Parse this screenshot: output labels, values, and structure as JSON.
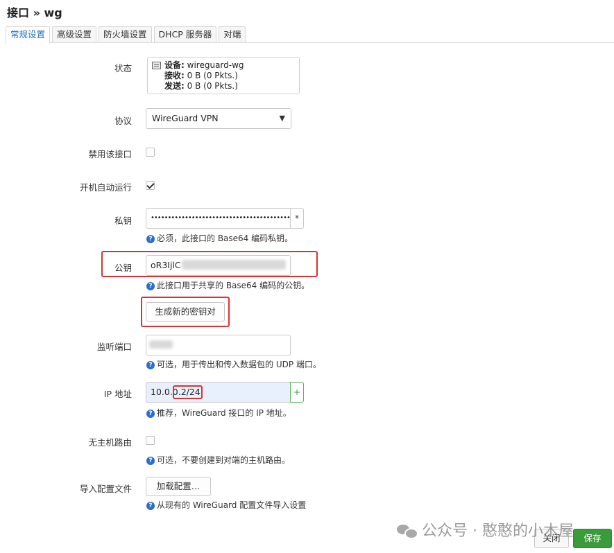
{
  "page": {
    "title": "接口 » wg"
  },
  "tabs": [
    "常规设置",
    "高级设置",
    "防火墙设置",
    "DHCP 服务器",
    "对端"
  ],
  "status": {
    "label": "状态",
    "device_key": "设备:",
    "device_value": "wireguard-wg",
    "rx_key": "接收:",
    "rx_value": "0 B (0 Pkts.)",
    "tx_key": "发送:",
    "tx_value": "0 B (0 Pkts.)"
  },
  "protocol": {
    "label": "协议",
    "value": "WireGuard VPN"
  },
  "disable": {
    "label": "禁用该接口",
    "checked": false
  },
  "autostart": {
    "label": "开机自动运行",
    "checked": true
  },
  "private_key": {
    "label": "私钥",
    "value": "•••••••••••••••••••••••••••••••••••••••••••",
    "toggle": "*",
    "help": "必须，此接口的 Base64 编码私钥。"
  },
  "public_key": {
    "label": "公钥",
    "value": "oR3IjlC",
    "help": "此接口用于共享的 Base64 编码的公钥。"
  },
  "generate": {
    "label": "生成新的密钥对"
  },
  "listen_port": {
    "label": "监听端口",
    "help": "可选，用于传出和传入数据包的 UDP 端口。"
  },
  "ip": {
    "label": "IP 地址",
    "value": "10.0.0.2/24",
    "add": "+",
    "help": "推荐，WireGuard 接口的 IP 地址。"
  },
  "nohostroute": {
    "label": "无主机路由",
    "checked": false,
    "help": "可选，不要创建到对端的主机路由。"
  },
  "import_config": {
    "label": "导入配置文件",
    "button": "加载配置…",
    "help": "从现有的 WireGuard 配置文件导入设置"
  },
  "watermark": "公众号 · 憨憨的小木屋",
  "footer": {
    "close": "关闭",
    "save": "保存"
  },
  "colors": {
    "accent": "#1e73c9",
    "highlight": "#e03030",
    "save": "#3a9b3a"
  }
}
